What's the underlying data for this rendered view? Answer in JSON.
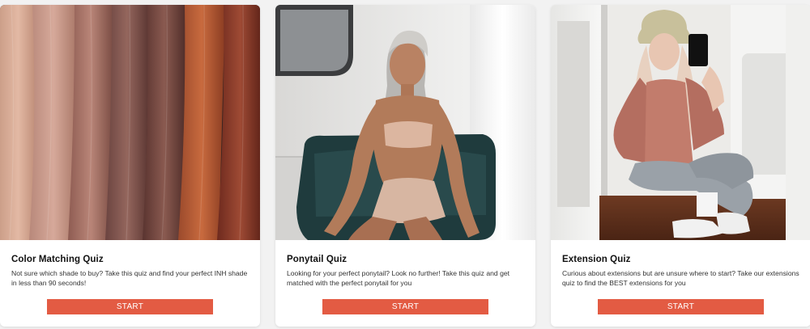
{
  "cards": [
    {
      "title": "Color Matching Quiz",
      "description": "Not sure which shade to buy? Take this quiz and find your perfect INH shade in less than 90 seconds!",
      "button_label": "START",
      "image_subject": "hair-color-swatches"
    },
    {
      "title": "Ponytail Quiz",
      "description": "Looking for your perfect ponytail? Look no further! Take this quiz and get matched with the perfect ponytail for you",
      "button_label": "START",
      "image_subject": "woman-with-ponytail-seated"
    },
    {
      "title": "Extension Quiz",
      "description": "Curious about extensions but are unsure where to start? Take our extensions quiz to find the BEST extensions for you",
      "button_label": "START",
      "image_subject": "woman-taking-mirror-selfie"
    }
  ],
  "colors": {
    "button": "#e35b43",
    "button_text": "#ffffff",
    "card_bg": "#ffffff",
    "page_bg": "#f2f2f2"
  }
}
